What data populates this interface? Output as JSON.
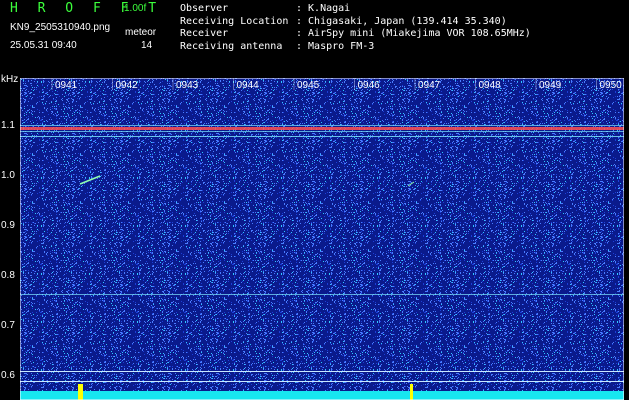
{
  "header": {
    "app_title": "H R O F F T",
    "version": "1.00f",
    "filename": "KN9_2505310940.png",
    "timestamp": "25.05.31 09:40",
    "counter_label": "meteor",
    "counter_value": "14",
    "info": [
      {
        "key": "Observer",
        "value": ": K.Nagai"
      },
      {
        "key": "Receiving Location",
        "value": ": Chigasaki, Japan (139.414 35.340)"
      },
      {
        "key": "Receiver",
        "value": ": AirSpy mini (Miakejima VOR 108.65MHz)"
      },
      {
        "key": "Receiving antenna",
        "value": ": Maspro FM-3"
      }
    ]
  },
  "plot": {
    "y_unit": "kHz",
    "y_ticks": [
      "1.1",
      "1.0",
      "0.9",
      "0.8",
      "0.7",
      "0.6"
    ],
    "time_labels": [
      "0941",
      "0942",
      "0943",
      "0944",
      "0945",
      "0946",
      "0947",
      "0948",
      "0949",
      "0950"
    ],
    "colors": {
      "background": "#0a1a8c",
      "noise_light": "#4a7dff",
      "noise_cyan": "#2ec8ff",
      "carrier": "#ff5050",
      "band": "#7fe8ff",
      "bottom_strip": "#17e6f0",
      "spike": "#ffff00"
    }
  }
}
